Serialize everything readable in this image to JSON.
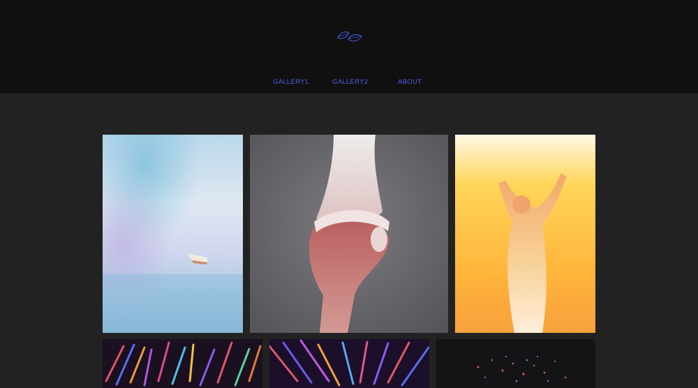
{
  "header": {
    "logo_icon": "twin-leaf-icon",
    "logo_color": "#3c55c8"
  },
  "nav": {
    "items": [
      {
        "label": "GALLERY1"
      },
      {
        "label": "GALLERY2"
      },
      {
        "label": "ABOUT"
      }
    ],
    "link_color": "#4a64e0"
  },
  "gallery": {
    "artworks": [
      {
        "name": "boat-in-mist-painting"
      },
      {
        "name": "holding-hands-painting"
      },
      {
        "name": "figure-in-golden-light-painting"
      },
      {
        "name": "abstract-strokes-painting-1"
      },
      {
        "name": "abstract-strokes-painting-2"
      },
      {
        "name": "dark-particles-painting"
      }
    ]
  },
  "colors": {
    "header_bg": "#101011",
    "page_bg": "#222222"
  }
}
